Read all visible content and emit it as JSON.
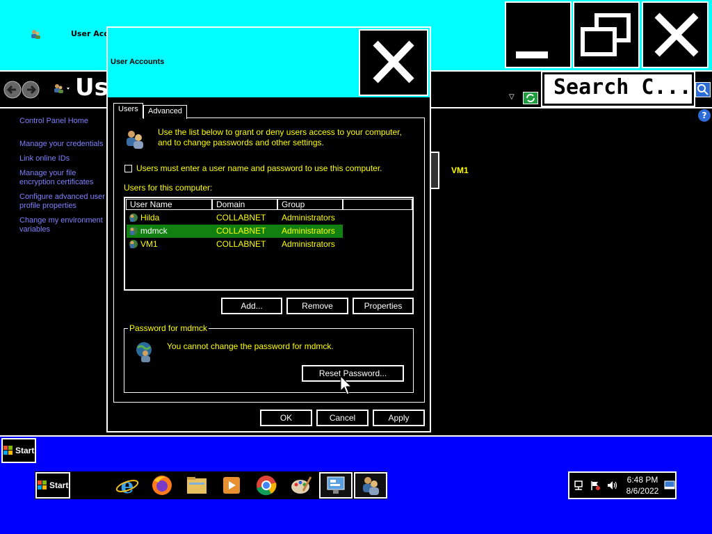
{
  "background_window": {
    "title": "User Acc",
    "address_title": "Use",
    "search_placeholder": "Search C...",
    "help": "?",
    "left_links": [
      "Control Panel Home",
      "Manage your credentials",
      "Link online IDs",
      "Manage your file encryption certificates",
      "Configure advanced user profile properties",
      "Change my environment variables"
    ],
    "account_name": "VM1"
  },
  "dialog": {
    "title": "User Accounts",
    "tabs": [
      "Users",
      "Advanced"
    ],
    "intro": "Use the list below to grant or deny users access to your computer, and to change passwords and other settings.",
    "checkbox_label": "Users must enter a user name and password to use this computer.",
    "checkbox_checked": false,
    "users_label": "Users for this computer:",
    "columns": [
      "User Name",
      "Domain",
      "Group"
    ],
    "users": [
      {
        "name": "Hilda",
        "domain": "COLLABNET",
        "group": "Administrators",
        "selected": false
      },
      {
        "name": "mdmck",
        "domain": "COLLABNET",
        "group": "Administrators",
        "selected": true
      },
      {
        "name": "VM1",
        "domain": "COLLABNET",
        "group": "Administrators",
        "selected": false
      }
    ],
    "buttons": {
      "add": "Add...",
      "remove": "Remove",
      "properties": "Properties"
    },
    "password_group": {
      "legend": "Password for mdmck",
      "message": "You cannot change the password for mdmck.",
      "reset_button": "Reset Password..."
    },
    "footer": {
      "ok": "OK",
      "cancel": "Cancel",
      "apply": "Apply"
    }
  },
  "taskbar": {
    "start_label": "Start",
    "time": "6:48 PM",
    "date": "8/6/2022"
  },
  "colors": {
    "title_bar": "#00ffff",
    "text_highlight": "#ffff00",
    "selection": "#108010",
    "taskbar": "#0000ff"
  }
}
